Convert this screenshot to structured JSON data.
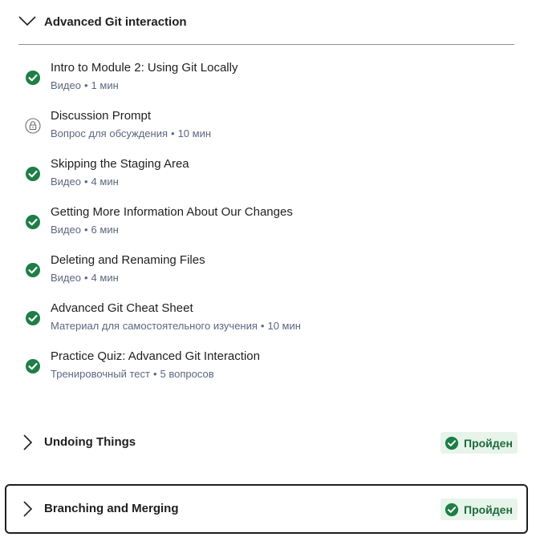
{
  "section": {
    "title": "Advanced Git interaction",
    "expanded": true
  },
  "lessons": [
    {
      "title": "Intro to Module 2: Using Git Locally",
      "type": "Видео",
      "duration": "1 мин",
      "status": "completed"
    },
    {
      "title": "Discussion Prompt",
      "type": "Вопрос для обсуждения",
      "duration": "10 мин",
      "status": "locked"
    },
    {
      "title": "Skipping the Staging Area",
      "type": "Видео",
      "duration": "4 мин",
      "status": "completed"
    },
    {
      "title": "Getting More Information About Our Changes",
      "type": "Видео",
      "duration": "6 мин",
      "status": "completed"
    },
    {
      "title": "Deleting and Renaming Files",
      "type": "Видео",
      "duration": "4 мин",
      "status": "completed"
    },
    {
      "title": "Advanced Git Cheat Sheet",
      "type": "Материал для самостоятельного изучения",
      "duration": "10 мин",
      "status": "completed"
    },
    {
      "title": "Practice Quiz: Advanced Git Interaction",
      "type": "Тренировочный тест",
      "duration": "5 вопросов",
      "status": "completed"
    }
  ],
  "separator": "•",
  "modules": [
    {
      "title": "Undoing Things",
      "status_label": "Пройден",
      "focused": false
    },
    {
      "title": "Branching and Merging",
      "status_label": "Пройден",
      "focused": true
    }
  ],
  "colors": {
    "completed_green": "#1e7e46",
    "badge_bg": "#e7f4ea",
    "badge_text": "#1e6b3c",
    "meta_text": "#5b6780",
    "locked_gray": "#6f6f6f"
  },
  "icons": {
    "expanded": "chevron-down-icon",
    "collapsed": "chevron-right-icon",
    "completed": "check-circle-icon",
    "locked": "lock-icon"
  }
}
